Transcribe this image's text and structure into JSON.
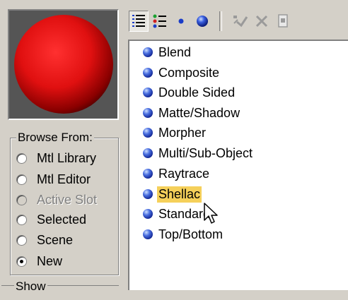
{
  "browse_from": {
    "title": "Browse From:",
    "options": [
      {
        "label": "Mtl Library",
        "checked": false,
        "enabled": true
      },
      {
        "label": "Mtl Editor",
        "checked": false,
        "enabled": true
      },
      {
        "label": "Active Slot",
        "checked": false,
        "enabled": false
      },
      {
        "label": "Selected",
        "checked": false,
        "enabled": true
      },
      {
        "label": "Scene",
        "checked": false,
        "enabled": true
      },
      {
        "label": "New",
        "checked": true,
        "enabled": true
      }
    ]
  },
  "show": {
    "title": "Show"
  },
  "materials": [
    {
      "label": "Blend"
    },
    {
      "label": "Composite"
    },
    {
      "label": "Double Sided"
    },
    {
      "label": "Matte/Shadow"
    },
    {
      "label": "Morpher"
    },
    {
      "label": "Multi/Sub-Object"
    },
    {
      "label": "Raytrace"
    },
    {
      "label": "Shellac",
      "selected": true
    },
    {
      "label": "Standard"
    },
    {
      "label": "Top/Bottom"
    }
  ],
  "colors": {
    "selection": "#f5d05a",
    "preview_bg": "#555555",
    "sphere": "#e01010"
  }
}
